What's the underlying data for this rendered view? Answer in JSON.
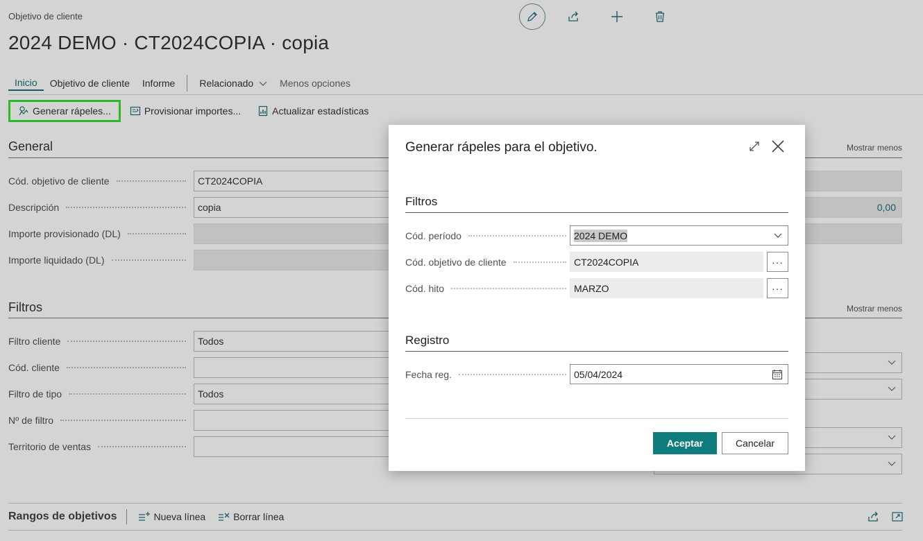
{
  "header": {
    "breadcrumb": "Objetivo de cliente",
    "title": "2024 DEMO · CT2024COPIA · copia"
  },
  "nav": {
    "tabs": [
      "Inicio",
      "Objetivo de cliente",
      "Informe"
    ],
    "related": "Relacionado",
    "less_options": "Menos opciones"
  },
  "toolbar": {
    "generate": "Generar rápeles...",
    "provision": "Provisionar importes...",
    "update_stats": "Actualizar estadísticas"
  },
  "general": {
    "title": "General",
    "show_less": "Mostrar menos",
    "fields": [
      {
        "label": "Cód. objetivo de cliente",
        "value": "CT2024COPIA"
      },
      {
        "label": "Descripción",
        "value": "copia"
      },
      {
        "label": "Importe provisionado (DL)",
        "value": ""
      },
      {
        "label": "Importe liquidado (DL)",
        "value": ""
      }
    ],
    "right_value": "0,00"
  },
  "filters": {
    "title": "Filtros",
    "show_less": "Mostrar menos",
    "fields": [
      {
        "label": "Filtro cliente",
        "value": "Todos"
      },
      {
        "label": "Cód. cliente",
        "value": ""
      },
      {
        "label": "Filtro de tipo",
        "value": "Todos"
      },
      {
        "label": "Nº de filtro",
        "value": ""
      },
      {
        "label": "Territorio de ventas",
        "value": ""
      }
    ]
  },
  "ranges": {
    "title": "Rangos de objetivos",
    "new_line": "Nueva línea",
    "delete_line": "Borrar línea"
  },
  "dialog": {
    "title": "Generar rápeles para el objetivo.",
    "filters_title": "Filtros",
    "period_label": "Cód. período",
    "period_value": "2024 DEMO",
    "target_label": "Cód. objetivo de cliente",
    "target_value": "CT2024COPIA",
    "milestone_label": "Cód. hito",
    "milestone_value": "MARZO",
    "dots": "···",
    "registry_title": "Registro",
    "date_label": "Fecha reg.",
    "date_value": "05/04/2024",
    "accept": "Aceptar",
    "cancel": "Cancelar"
  },
  "colors": {
    "accent": "#0f7c7e",
    "highlight": "#33e033"
  },
  "icons": [
    "edit-icon",
    "share-icon",
    "plus-icon",
    "trash-icon",
    "expand-icon",
    "close-icon",
    "chevron-down-icon",
    "calendar-icon"
  ]
}
